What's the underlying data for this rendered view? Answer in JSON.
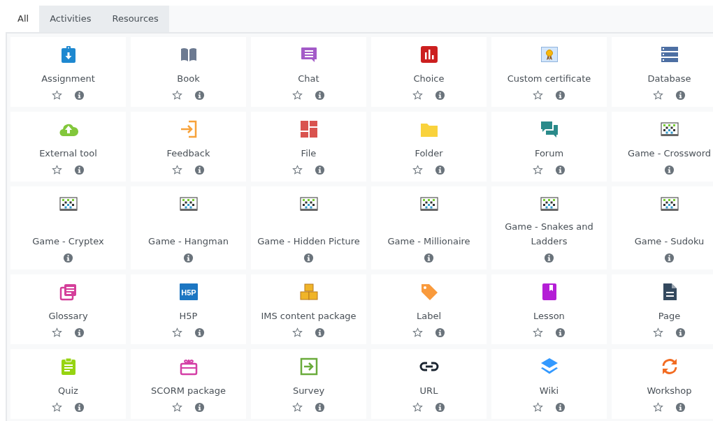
{
  "tabs": [
    {
      "label": "All",
      "selected": true
    },
    {
      "label": "Activities",
      "selected": false
    },
    {
      "label": "Resources",
      "selected": false
    }
  ],
  "items": [
    {
      "name": "Assignment",
      "starred": false
    },
    {
      "name": "Book",
      "starred": false
    },
    {
      "name": "Chat",
      "starred": false
    },
    {
      "name": "Choice",
      "starred": false
    },
    {
      "name": "Custom certificate",
      "starred": false
    },
    {
      "name": "Database",
      "starred": false
    },
    {
      "name": "External tool",
      "starred": false
    },
    {
      "name": "Feedback",
      "starred": false
    },
    {
      "name": "File",
      "starred": false
    },
    {
      "name": "Folder",
      "starred": false
    },
    {
      "name": "Forum",
      "starred": false
    },
    {
      "name": "Game - Crossword"
    },
    {
      "name": "Game - Cryptex"
    },
    {
      "name": "Game - Hangman"
    },
    {
      "name": "Game - Hidden Picture"
    },
    {
      "name": "Game - Millionaire"
    },
    {
      "name": "Game - Snakes and Ladders"
    },
    {
      "name": "Game - Sudoku"
    },
    {
      "name": "Glossary",
      "starred": false
    },
    {
      "name": "H5P",
      "starred": false,
      "icon_text": "H5P"
    },
    {
      "name": "IMS content package",
      "starred": false
    },
    {
      "name": "Label",
      "starred": false
    },
    {
      "name": "Lesson",
      "starred": false
    },
    {
      "name": "Page",
      "starred": false
    },
    {
      "name": "Quiz",
      "starred": false
    },
    {
      "name": "SCORM package",
      "starred": false
    },
    {
      "name": "Survey",
      "starred": false
    },
    {
      "name": "URL",
      "starred": false
    },
    {
      "name": "Wiki",
      "starred": false
    },
    {
      "name": "Workshop",
      "starred": false
    }
  ]
}
